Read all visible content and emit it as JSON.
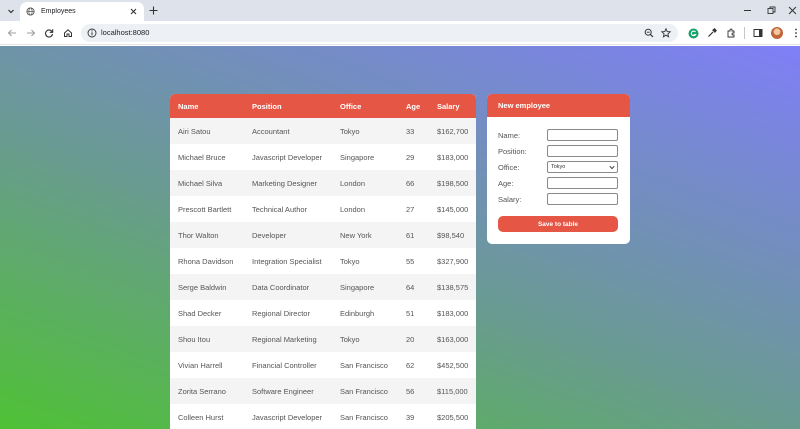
{
  "browser": {
    "tab_title": "Employees",
    "url": "localhost:8080"
  },
  "table": {
    "headers": [
      "Name",
      "Position",
      "Office",
      "Age",
      "Salary"
    ],
    "rows": [
      [
        "Airi Satou",
        "Accountant",
        "Tokyo",
        "33",
        "$162,700"
      ],
      [
        "Michael Bruce",
        "Javascript Developer",
        "Singapore",
        "29",
        "$183,000"
      ],
      [
        "Michael Silva",
        "Marketing Designer",
        "London",
        "66",
        "$198,500"
      ],
      [
        "Prescott Bartlett",
        "Technical Author",
        "London",
        "27",
        "$145,000"
      ],
      [
        "Thor Walton",
        "Developer",
        "New York",
        "61",
        "$98,540"
      ],
      [
        "Rhona Davidson",
        "Integration Specialist",
        "Tokyo",
        "55",
        "$327,900"
      ],
      [
        "Serge Baldwin",
        "Data Coordinator",
        "Singapore",
        "64",
        "$138,575"
      ],
      [
        "Shad Decker",
        "Regional Director",
        "Edinburgh",
        "51",
        "$183,000"
      ],
      [
        "Shou Itou",
        "Regional Marketing",
        "Tokyo",
        "20",
        "$163,000"
      ],
      [
        "Vivian Harrell",
        "Financial Controller",
        "San Francisco",
        "62",
        "$452,500"
      ],
      [
        "Zorita Serrano",
        "Software Engineer",
        "San Francisco",
        "56",
        "$115,000"
      ],
      [
        "Colleen Hurst",
        "Javascript Developer",
        "San Francisco",
        "39",
        "$205,500"
      ]
    ]
  },
  "form": {
    "title": "New employee",
    "name_label": "Name:",
    "position_label": "Position:",
    "office_label": "Office:",
    "office_selected": "Tokyo",
    "age_label": "Age:",
    "salary_label": "Salary:",
    "save_label": "Save to table"
  },
  "colors": {
    "accent": "#e55744",
    "gradient_start": "#4fc135",
    "gradient_end": "#7f7ff7"
  }
}
